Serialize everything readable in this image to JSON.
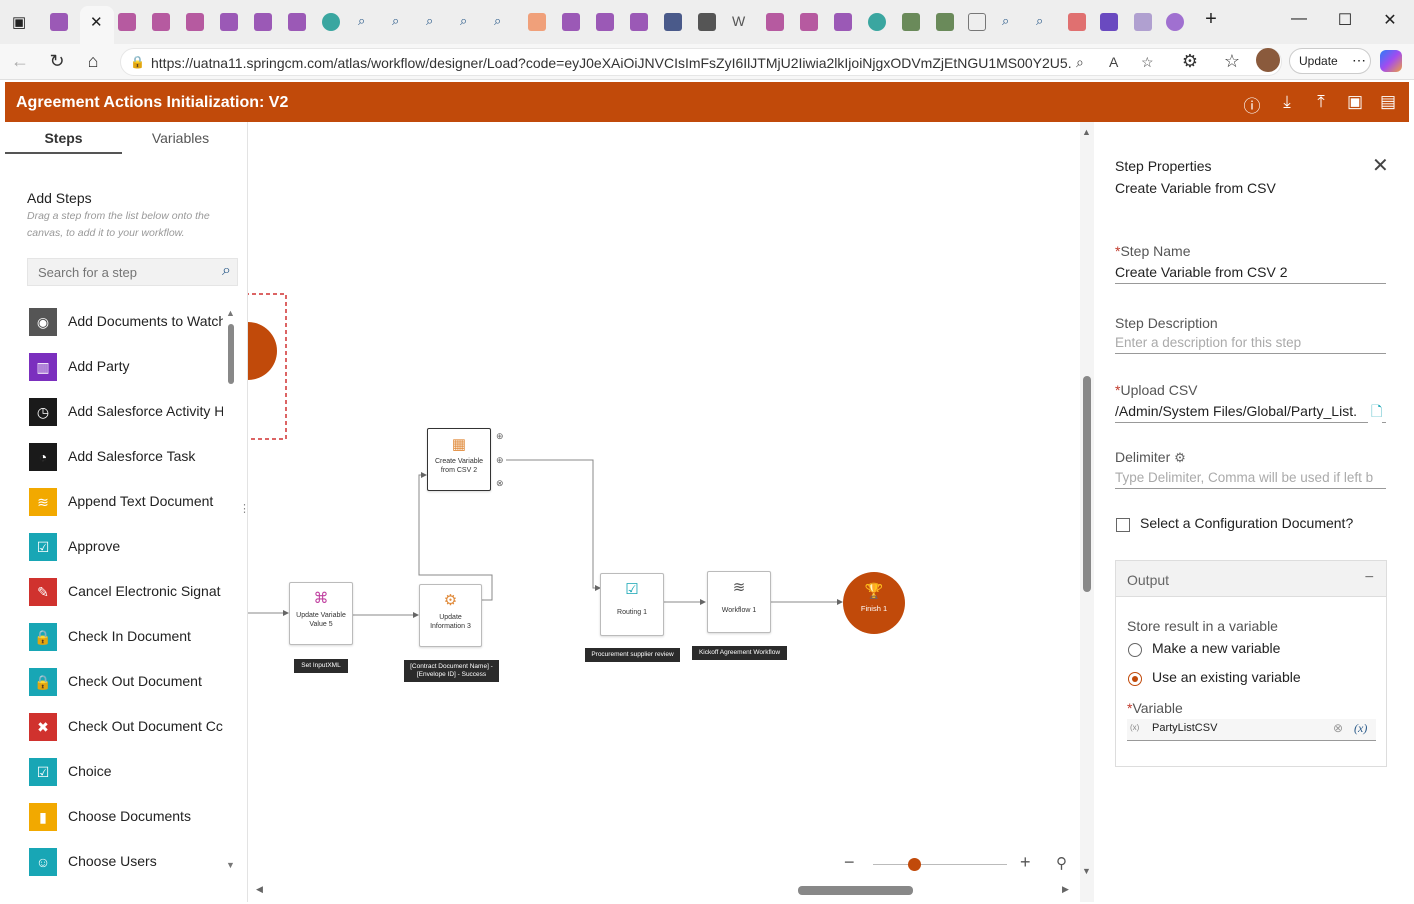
{
  "browser": {
    "url": "https://uatna11.springcm.com/atlas/workflow/designer/Load?code=eyJ0eXAiOiJNVCIsImFsZyI6IlJTMjU2Iiwia2lkIjoiNjgxODVmZjEtNGU1MS00Y2U5...",
    "update_label": "Update",
    "new_tab_symbol": "+"
  },
  "app": {
    "title": "Agreement Actions Initialization: V2"
  },
  "left_panel": {
    "tabs": [
      "Steps",
      "Variables"
    ],
    "add_steps_title": "Add Steps",
    "add_steps_desc": "Drag a step from the list below onto the canvas, to add it to your workflow.",
    "search_placeholder": "Search for a step",
    "steps": [
      {
        "label": "Add Documents to Watch",
        "color": "#555555",
        "icon": "eye-icon"
      },
      {
        "label": "Add Party",
        "color": "#7b2fbe",
        "icon": "chart-icon"
      },
      {
        "label": "Add Salesforce Activity H",
        "color": "#1a1a1a",
        "icon": "clock-icon"
      },
      {
        "label": "Add Salesforce Task",
        "color": "#1a1a1a",
        "icon": "task-icon"
      },
      {
        "label": "Append Text Document",
        "color": "#f2a900",
        "icon": "database-icon"
      },
      {
        "label": "Approve",
        "color": "#18a6b5",
        "icon": "check-icon"
      },
      {
        "label": "Cancel Electronic Signat",
        "color": "#d0322e",
        "icon": "signature-icon"
      },
      {
        "label": "Check In Document",
        "color": "#18a6b5",
        "icon": "lock-icon"
      },
      {
        "label": "Check Out Document",
        "color": "#18a6b5",
        "icon": "lock-icon"
      },
      {
        "label": "Check Out Document Cc",
        "color": "#d0322e",
        "icon": "lock-x-icon"
      },
      {
        "label": "Choice",
        "color": "#18a6b5",
        "icon": "check-icon"
      },
      {
        "label": "Choose Documents",
        "color": "#f2a900",
        "icon": "documents-icon"
      },
      {
        "label": "Choose Users",
        "color": "#18a6b5",
        "icon": "user-icon"
      }
    ]
  },
  "canvas": {
    "nodes": {
      "create_variable": "Create Variable from CSV 2",
      "update_variable": "Update Variable Value 5",
      "update_information": "Update Information 3",
      "routing": "Routing 1",
      "workflow": "Workflow 1",
      "finish": "Finish 1"
    },
    "tags": {
      "set_input": "Set InputXML",
      "contract": "[Contract Document Name] - [Envelope ID] - Success",
      "procurement": "Procurement supplier review",
      "kickoff": "Kickoff Agreement Workflow"
    }
  },
  "properties": {
    "title": "Step Properties",
    "subtitle": "Create Variable from CSV",
    "step_name_label": "Step Name",
    "step_name_value": "Create Variable from CSV 2",
    "step_desc_label": "Step Description",
    "step_desc_placeholder": "Enter a description for this step",
    "upload_label": "Upload CSV",
    "upload_value": "/Admin/System Files/Global/Party_List.",
    "delimiter_label": "Delimiter",
    "delimiter_placeholder": "Type Delimiter, Comma will be used if left b",
    "config_label": "Select a Configuration Document?",
    "output_title": "Output",
    "store_label": "Store result in a variable",
    "option_new": "Make a new variable",
    "option_existing": "Use an existing variable",
    "variable_label": "Variable",
    "variable_value": "PartyListCSV",
    "selected_option": "existing"
  },
  "colors": {
    "brand": "#c14a0a"
  }
}
